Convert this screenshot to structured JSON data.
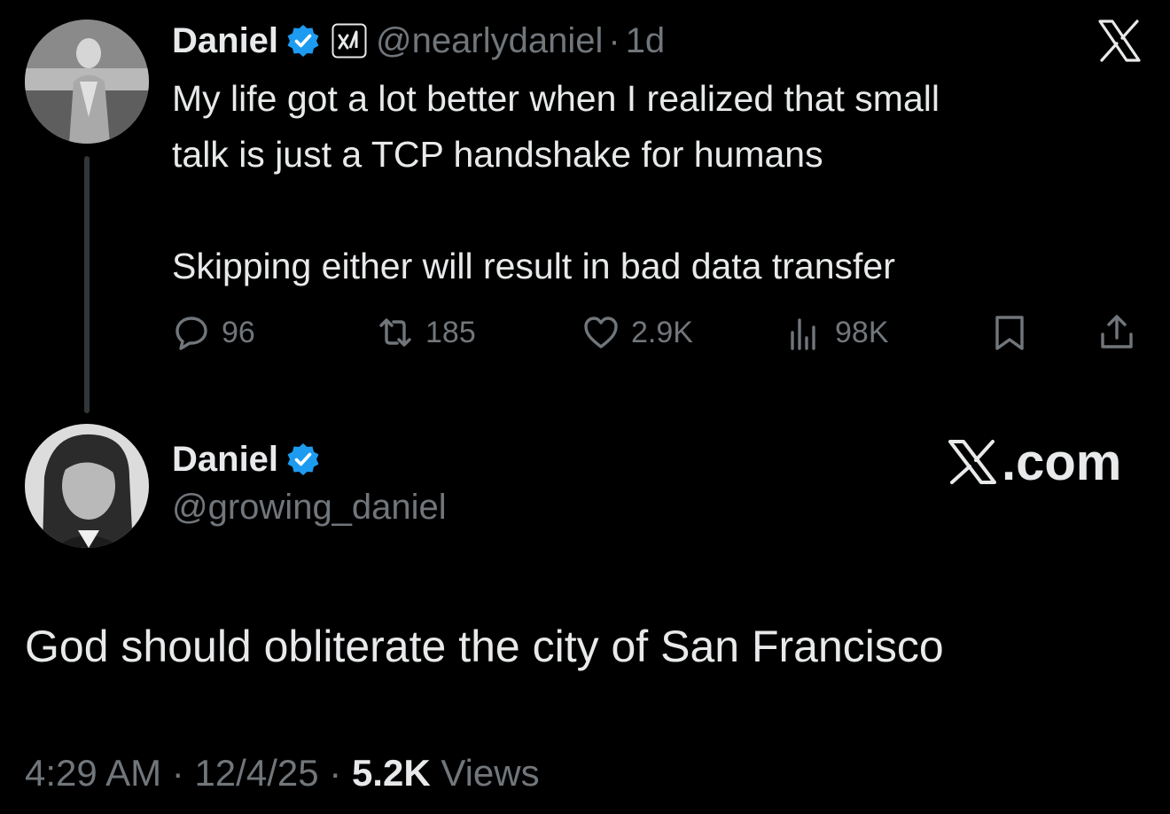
{
  "colors": {
    "background": "#000000",
    "primary_text": "#e7e9ea",
    "secondary_text": "#71767b",
    "verified_blue": "#1d9bf0",
    "thread_line": "#333639"
  },
  "tweet": {
    "author_name": "Daniel",
    "author_handle": "@nearlydaniel",
    "separator": "·",
    "age": "1d",
    "text": "My life got a lot better when I realized that small\ntalk is just a TCP handshake for humans\n\nSkipping either will result in bad data transfer",
    "actions": {
      "replies": "96",
      "reposts": "185",
      "likes": "2.9K",
      "views": "98K"
    },
    "icons": [
      "reply-icon",
      "repost-icon",
      "like-icon",
      "views-icon",
      "bookmark-icon",
      "share-icon",
      "x-logo-icon",
      "verified-badge-icon",
      "affiliate-logo-icon"
    ]
  },
  "quoted": {
    "author_name": "Daniel",
    "author_handle": "@growing_daniel",
    "brand_text": ".com",
    "text": "God should obliterate the city of San Francisco",
    "time": "4:29 AM",
    "sep1": "·",
    "date": "12/4/25",
    "sep2": "·",
    "views_count": "5.2K",
    "views_label": "Views"
  }
}
